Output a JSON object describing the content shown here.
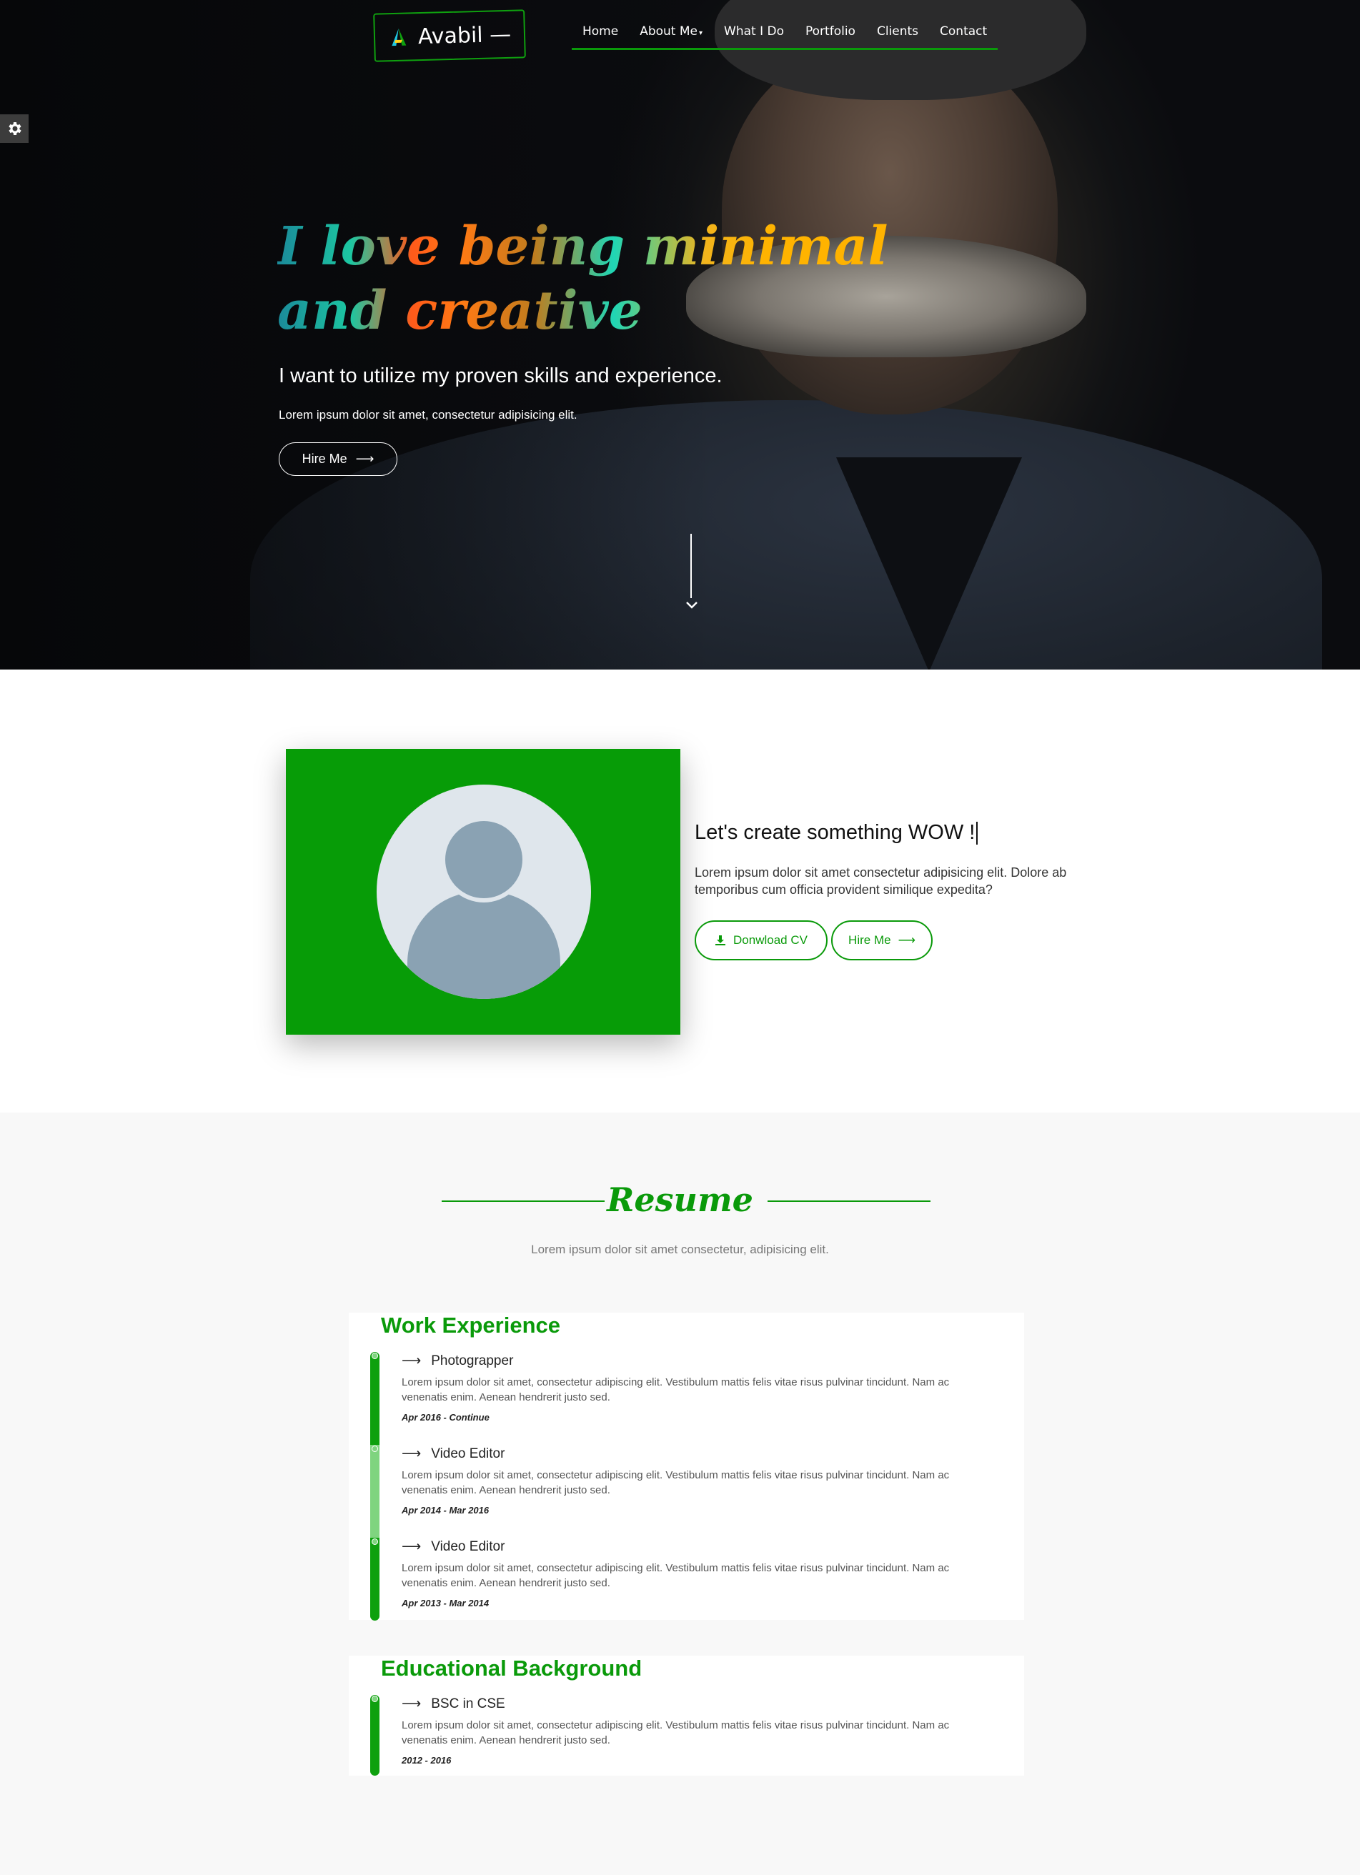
{
  "brand": {
    "name": "Avabil —"
  },
  "nav": {
    "items": [
      "Home",
      "About Me",
      "What I Do",
      "Portfolio",
      "Clients",
      "Contact"
    ],
    "about_caret": "▾"
  },
  "hero": {
    "headline_line1": "I love being minimal",
    "headline_line2": "and creative",
    "subheadline": "I want to utilize my proven skills and experience.",
    "text": "Lorem ipsum dolor sit amet, consectetur adipisicing elit.",
    "hire_label": "Hire Me",
    "arrow": "⟶"
  },
  "about": {
    "title": "Let's create something WOW !",
    "text": "Lorem ipsum dolor sit amet consectetur adipisicing elit. Dolore ab temporibus cum officia provident similique expedita?",
    "download_label": "Donwload CV",
    "hire_label": "Hire Me",
    "arrow": "⟶"
  },
  "resume": {
    "title": "Resume",
    "subtitle": "Lorem ipsum dolor sit amet consectetur, adipisicing elit.",
    "work": {
      "title": "Work Experience",
      "entries": [
        {
          "role": "Photograpper",
          "text": "Lorem ipsum dolor sit amet, consectetur adipiscing elit. Vestibulum mattis felis vitae risus pulvinar tincidunt. Nam ac venenatis enim. Aenean hendrerit justo sed.",
          "date": "Apr 2016 - Continue"
        },
        {
          "role": "Video Editor",
          "text": "Lorem ipsum dolor sit amet, consectetur adipiscing elit. Vestibulum mattis felis vitae risus pulvinar tincidunt. Nam ac venenatis enim. Aenean hendrerit justo sed.",
          "date": "Apr 2014 - Mar 2016"
        },
        {
          "role": "Video Editor",
          "text": "Lorem ipsum dolor sit amet, consectetur adipiscing elit. Vestibulum mattis felis vitae risus pulvinar tincidunt. Nam ac venenatis enim. Aenean hendrerit justo sed.",
          "date": "Apr 2013 - Mar 2014"
        }
      ]
    },
    "education": {
      "title": "Educational Background",
      "entries": [
        {
          "role": "BSC in CSE",
          "text": "Lorem ipsum dolor sit amet, consectetur adipiscing elit. Vestibulum mattis felis vitae risus pulvinar tincidunt. Nam ac venenatis enim. Aenean hendrerit justo sed.",
          "date": "2012 - 2016"
        }
      ]
    }
  },
  "colors": {
    "accent": "#0a9a0a",
    "hero_bg": "#111214",
    "photo_card": "#079c07"
  },
  "icons": {
    "logo": "avabil-logo-icon",
    "settings": "gear-icon",
    "scroll": "chevron-down-icon",
    "download": "download-icon",
    "avatar": "user-avatar-icon"
  }
}
